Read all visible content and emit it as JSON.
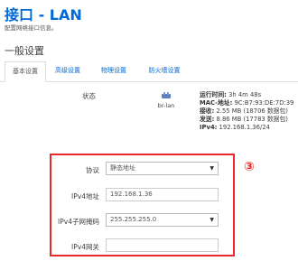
{
  "header": {
    "title": "接口 - LAN",
    "subtitle": "配置网络接口信息。"
  },
  "section": {
    "title": "一般设置"
  },
  "tabs": [
    {
      "label": "基本设置"
    },
    {
      "label": "高级设置"
    },
    {
      "label": "物理设置"
    },
    {
      "label": "防火墙设置"
    }
  ],
  "status": {
    "label": "状态",
    "iface_name": "br-lan",
    "lines": [
      {
        "key": "运行时间:",
        "value": " 3h 4m 48s"
      },
      {
        "key": "MAC-地址:",
        "value": " 9C:B7:93:DE:7D:39"
      },
      {
        "key": "接收:",
        "value": " 2.55 MB (18706 数据包)"
      },
      {
        "key": "发送:",
        "value": " 8.86 MB (17783 数据包)"
      },
      {
        "key": "IPv4:",
        "value": " 192.168.1.36/24"
      }
    ]
  },
  "badge": "③",
  "form": {
    "protocol": {
      "label": "协议",
      "value": "静态地址"
    },
    "ipv4_address": {
      "label": "IPv4地址",
      "value": "192.168.1.36"
    },
    "ipv4_netmask": {
      "label": "IPv4子网掩码",
      "value": "255.255.255.0"
    },
    "ipv4_gateway": {
      "label": "IPv4网关",
      "value": ""
    }
  },
  "colors": {
    "accent": "#0069d6",
    "highlight": "#e8282a"
  }
}
